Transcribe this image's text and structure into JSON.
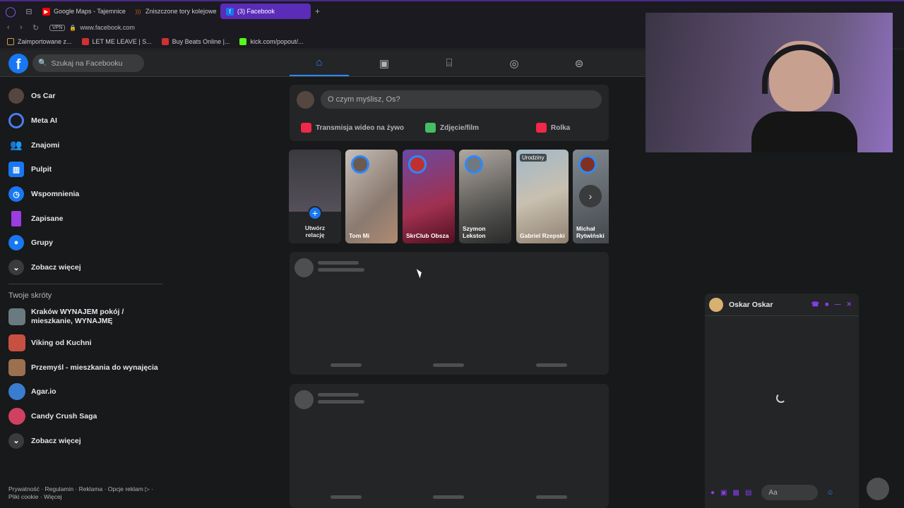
{
  "browser": {
    "tabs": [
      {
        "label": "Google Maps - Tajemnice",
        "icon": "youtube-icon",
        "color": "#ff0000"
      },
      {
        "label": "Zniszczone tory kolejowe",
        "icon": "podcast-icon",
        "color": "#e05a1a"
      },
      {
        "label": "(3) Facebook",
        "icon": "facebook-icon",
        "color": "#1877f2",
        "active": true
      }
    ],
    "new_tab": "+",
    "vpn": "VPN",
    "url": "www.facebook.com",
    "bookmarks": [
      {
        "label": "Zaimportowane z...",
        "color": "#c8a040"
      },
      {
        "label": "LET ME LEAVE | S...",
        "color": "#d03030"
      },
      {
        "label": "Buy Beats Online |...",
        "color": "#d03030"
      },
      {
        "label": "kick.com/popout/...",
        "color": "#53fc18"
      }
    ]
  },
  "facebook": {
    "logo": "f",
    "search_placeholder": "Szukaj na Facebooku",
    "left_nav": [
      {
        "label": "Os Car",
        "icon": "profile-avatar"
      },
      {
        "label": "Meta AI",
        "icon": "meta-ai-icon"
      },
      {
        "label": "Znajomi",
        "icon": "friends-icon"
      },
      {
        "label": "Pulpit",
        "icon": "dashboard-icon"
      },
      {
        "label": "Wspomnienia",
        "icon": "memories-icon"
      },
      {
        "label": "Zapisane",
        "icon": "saved-icon"
      },
      {
        "label": "Grupy",
        "icon": "groups-icon"
      },
      {
        "label": "Zobacz więcej",
        "icon": "chevron-down-icon"
      }
    ],
    "shortcuts_heading": "Twoje skróty",
    "shortcuts": [
      {
        "label": "Kraków WYNAJEM pokój / mieszkanie, WYNAJMĘ"
      },
      {
        "label": "Viking od Kuchni"
      },
      {
        "label": "Przemyśl - mieszkania do wynajęcia"
      },
      {
        "label": "Agar.io"
      },
      {
        "label": "Candy Crush Saga"
      },
      {
        "label": "Zobacz więcej"
      }
    ],
    "footer_line1": "Prywatność · Regulamin · Reklama · Opcje reklam ▷ ·",
    "footer_line2": "Pliki cookie · Więcej",
    "composer": {
      "placeholder": "O czym myślisz, Os?",
      "actions": [
        "Transmisja wideo na żywo",
        "Zdjęcie/film",
        "Rolka"
      ]
    },
    "stories": [
      {
        "name": "Utwórz relację"
      },
      {
        "name": "Tom Mi"
      },
      {
        "name": "SkrClub Obsza"
      },
      {
        "name": "Szymon Lekston"
      },
      {
        "name": "Gabriel Rzepski",
        "badge": "Urodziny"
      },
      {
        "name": "Michał Rytwiński"
      }
    ]
  },
  "chat": {
    "name": "Oskar Oskar",
    "input_placeholder": "Aa"
  }
}
